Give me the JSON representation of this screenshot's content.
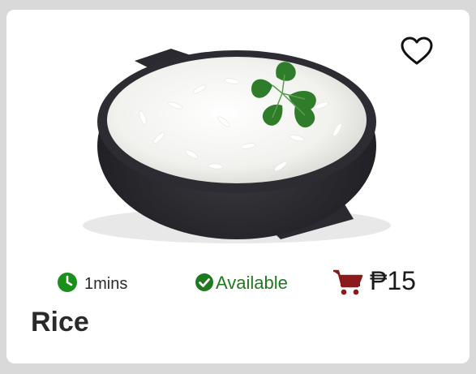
{
  "card": {
    "title": "Rice",
    "prep_time": "1mins",
    "availability": "Available",
    "price": "₱15"
  },
  "colors": {
    "time_icon": "#1a8f1a",
    "available": "#1f7a1f",
    "cart": "#8b1a1a"
  },
  "icons": {
    "favorite": "heart-outline-icon",
    "time": "clock-icon",
    "availability": "check-circle-icon",
    "cart": "shopping-cart-icon"
  }
}
